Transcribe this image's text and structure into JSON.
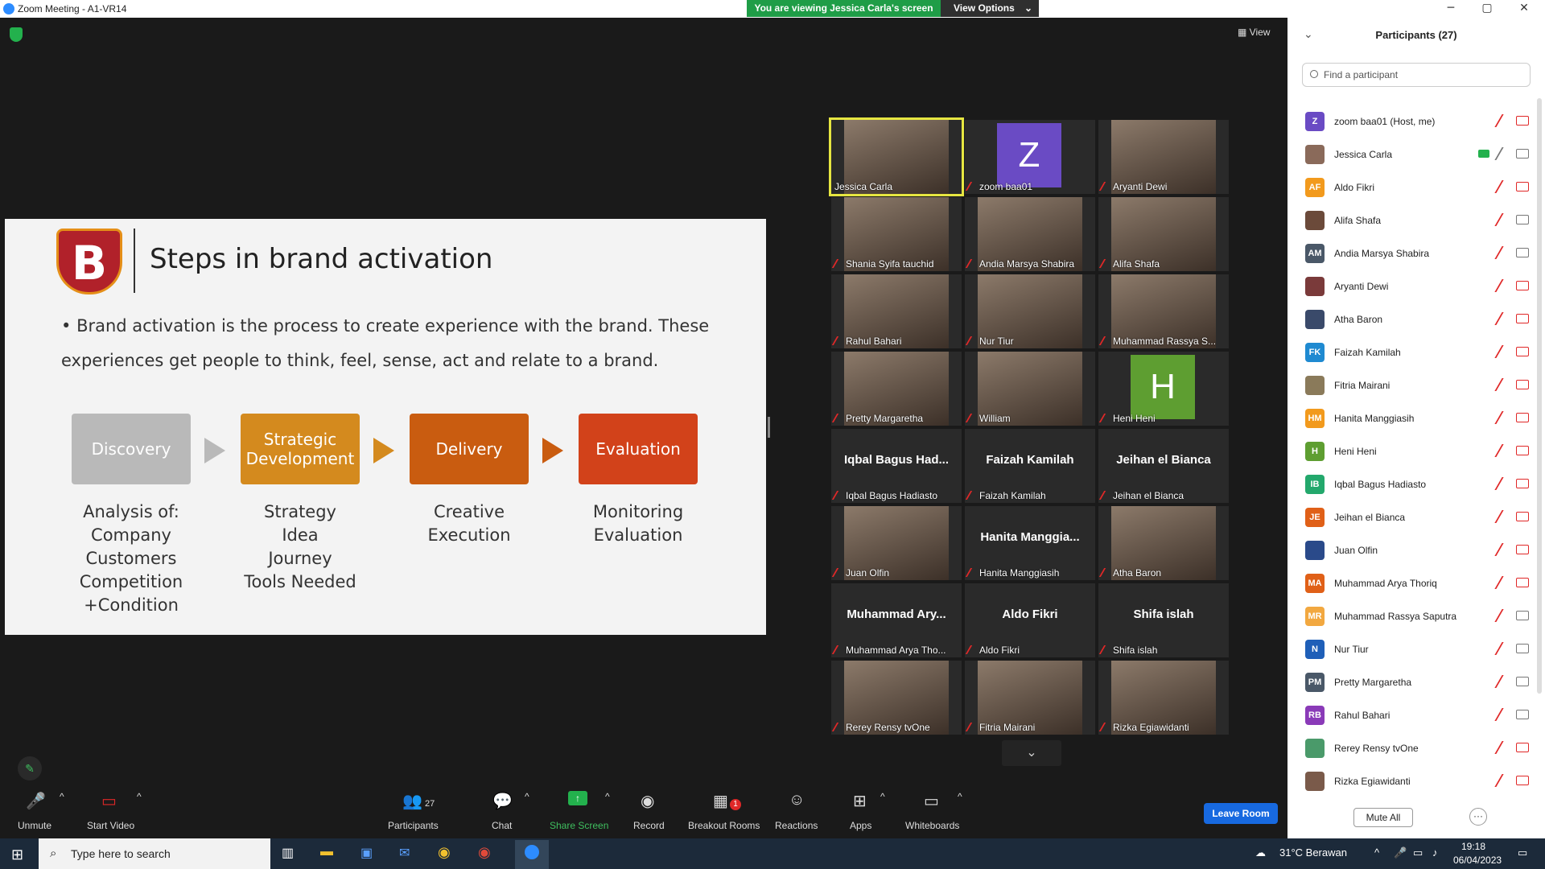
{
  "window": {
    "title": "Zoom Meeting - A1-VR14"
  },
  "banner": {
    "viewing": "You are viewing Jessica Carla's screen",
    "view_options": "View Options"
  },
  "meeting": {
    "view_label": "View"
  },
  "slide": {
    "logo_letter": "B",
    "title": "Steps in brand activation",
    "bullet": "Brand activation is the process to create experience with the brand. These experiences get people to think, feel, sense, act and relate to a brand.",
    "steps": [
      {
        "label": "Discovery",
        "color": "#b9b9b9",
        "detail": "Analysis of:\nCompany\nCustomers\nCompetition\n+Condition"
      },
      {
        "label": "Strategic Development",
        "color": "#d48a1e",
        "detail": "Strategy\nIdea\nJourney\nTools Needed"
      },
      {
        "label": "Delivery",
        "color": "#c95c10",
        "detail": "Creative\nExecution"
      },
      {
        "label": "Evaluation",
        "color": "#d2421a",
        "detail": "Monitoring\nEvaluation"
      }
    ]
  },
  "tiles": [
    {
      "name": "Jessica Carla",
      "kind": "video",
      "muted": false,
      "active": true
    },
    {
      "name": "zoom baa01",
      "kind": "avatar",
      "avatar": "Z",
      "color": "#6a4bc4",
      "muted": true
    },
    {
      "name": "Aryanti Dewi",
      "kind": "video",
      "muted": true
    },
    {
      "name": "Shania Syifa tauchid",
      "kind": "video",
      "muted": true
    },
    {
      "name": "Andia Marsya Shabira",
      "kind": "video",
      "muted": true
    },
    {
      "name": "Alifa Shafa",
      "kind": "video",
      "muted": true
    },
    {
      "name": "Rahul Bahari",
      "kind": "video",
      "muted": true
    },
    {
      "name": "Nur Tiur",
      "kind": "video",
      "muted": true
    },
    {
      "name": "Muhammad Rassya S...",
      "kind": "video",
      "muted": true
    },
    {
      "name": "Pretty Margaretha",
      "kind": "video",
      "muted": true
    },
    {
      "name": "William",
      "kind": "video",
      "muted": true
    },
    {
      "name": "Heni Heni",
      "kind": "avatar",
      "avatar": "H",
      "color": "#5e9e31",
      "muted": true
    },
    {
      "name": "Iqbal Bagus Hadiasto",
      "big": "Iqbal Bagus Had...",
      "kind": "text",
      "muted": true
    },
    {
      "name": "Faizah Kamilah",
      "big": "Faizah Kamilah",
      "kind": "text",
      "muted": true
    },
    {
      "name": "Jeihan el Bianca",
      "big": "Jeihan el Bianca",
      "kind": "text",
      "muted": true
    },
    {
      "name": "Juan Olfin",
      "kind": "video",
      "muted": true
    },
    {
      "name": "Hanita Manggiasih",
      "big": "Hanita Manggia...",
      "kind": "text",
      "muted": true
    },
    {
      "name": "Atha Baron",
      "kind": "video",
      "muted": true
    },
    {
      "name": "Muhammad Arya Tho...",
      "big": "Muhammad Ary...",
      "kind": "text",
      "muted": true
    },
    {
      "name": "Aldo Fikri",
      "big": "Aldo Fikri",
      "kind": "text",
      "muted": true
    },
    {
      "name": "Shifa islah",
      "big": "Shifa islah",
      "kind": "text",
      "muted": true
    },
    {
      "name": "Rerey Rensy tvOne",
      "kind": "video",
      "muted": true
    },
    {
      "name": "Fitria Mairani",
      "kind": "video",
      "muted": true
    },
    {
      "name": "Rizka Egiawidanti",
      "kind": "video",
      "muted": true
    }
  ],
  "toolbar": {
    "unmute": "Unmute",
    "start_video": "Start Video",
    "participants": "Participants",
    "participants_count": "27",
    "chat": "Chat",
    "share_screen": "Share Screen",
    "record": "Record",
    "breakout": "Breakout Rooms",
    "breakout_badge": "1",
    "reactions": "Reactions",
    "apps": "Apps",
    "whiteboards": "Whiteboards",
    "leave": "Leave Room"
  },
  "panel": {
    "title": "Participants (27)",
    "search_placeholder": "Find a participant",
    "mute_all": "Mute All",
    "more": "···",
    "participants": [
      {
        "name": "zoom baa01 (Host, me)",
        "initials": "Z",
        "color": "#6a4bc4",
        "video_off": true
      },
      {
        "name": "Jessica Carla",
        "initials": "",
        "color": "#8a6a5a",
        "video_off": false,
        "sharing": true
      },
      {
        "name": "Aldo Fikri",
        "initials": "AF",
        "color": "#f29a1d",
        "video_off": true
      },
      {
        "name": "Alifa Shafa",
        "initials": "",
        "color": "#6b4a3a",
        "video_off": false
      },
      {
        "name": "Andia Marsya Shabira",
        "initials": "AM",
        "color": "#4a5868",
        "video_off": false
      },
      {
        "name": "Aryanti Dewi",
        "initials": "",
        "color": "#7a3a3a",
        "video_off": true
      },
      {
        "name": "Atha Baron",
        "initials": "",
        "color": "#3a4a6a",
        "video_off": true
      },
      {
        "name": "Faizah Kamilah",
        "initials": "FK",
        "color": "#1f8ad1",
        "video_off": true
      },
      {
        "name": "Fitria Mairani",
        "initials": "",
        "color": "#8a7a5a",
        "video_off": true
      },
      {
        "name": "Hanita Manggiasih",
        "initials": "HM",
        "color": "#f29a1d",
        "video_off": true
      },
      {
        "name": "Heni Heni",
        "initials": "H",
        "color": "#5e9e31",
        "video_off": true
      },
      {
        "name": "Iqbal Bagus Hadiasto",
        "initials": "IB",
        "color": "#23a86c",
        "video_off": true
      },
      {
        "name": "Jeihan el Bianca",
        "initials": "JE",
        "color": "#e06018",
        "video_off": true
      },
      {
        "name": "Juan Olfin",
        "initials": "",
        "color": "#2a4a8a",
        "video_off": true
      },
      {
        "name": "Muhammad Arya Thoriq",
        "initials": "MA",
        "color": "#e06018",
        "video_off": true
      },
      {
        "name": "Muhammad Rassya Saputra",
        "initials": "MR",
        "color": "#f2a840",
        "video_off": false
      },
      {
        "name": "Nur Tiur",
        "initials": "N",
        "color": "#1f5fb8",
        "video_off": false
      },
      {
        "name": "Pretty Margaretha",
        "initials": "PM",
        "color": "#4a5868",
        "video_off": false
      },
      {
        "name": "Rahul Bahari",
        "initials": "RB",
        "color": "#8a3ab8",
        "video_off": false
      },
      {
        "name": "Rerey Rensy tvOne",
        "initials": "",
        "color": "#4a9a6a",
        "video_off": true
      },
      {
        "name": "Rizka Egiawidanti",
        "initials": "",
        "color": "#7a5a4a",
        "video_off": true
      }
    ]
  },
  "taskbar": {
    "search_placeholder": "Type here to search",
    "weather": "31°C  Berawan",
    "time": "19:18",
    "date": "06/04/2023"
  }
}
